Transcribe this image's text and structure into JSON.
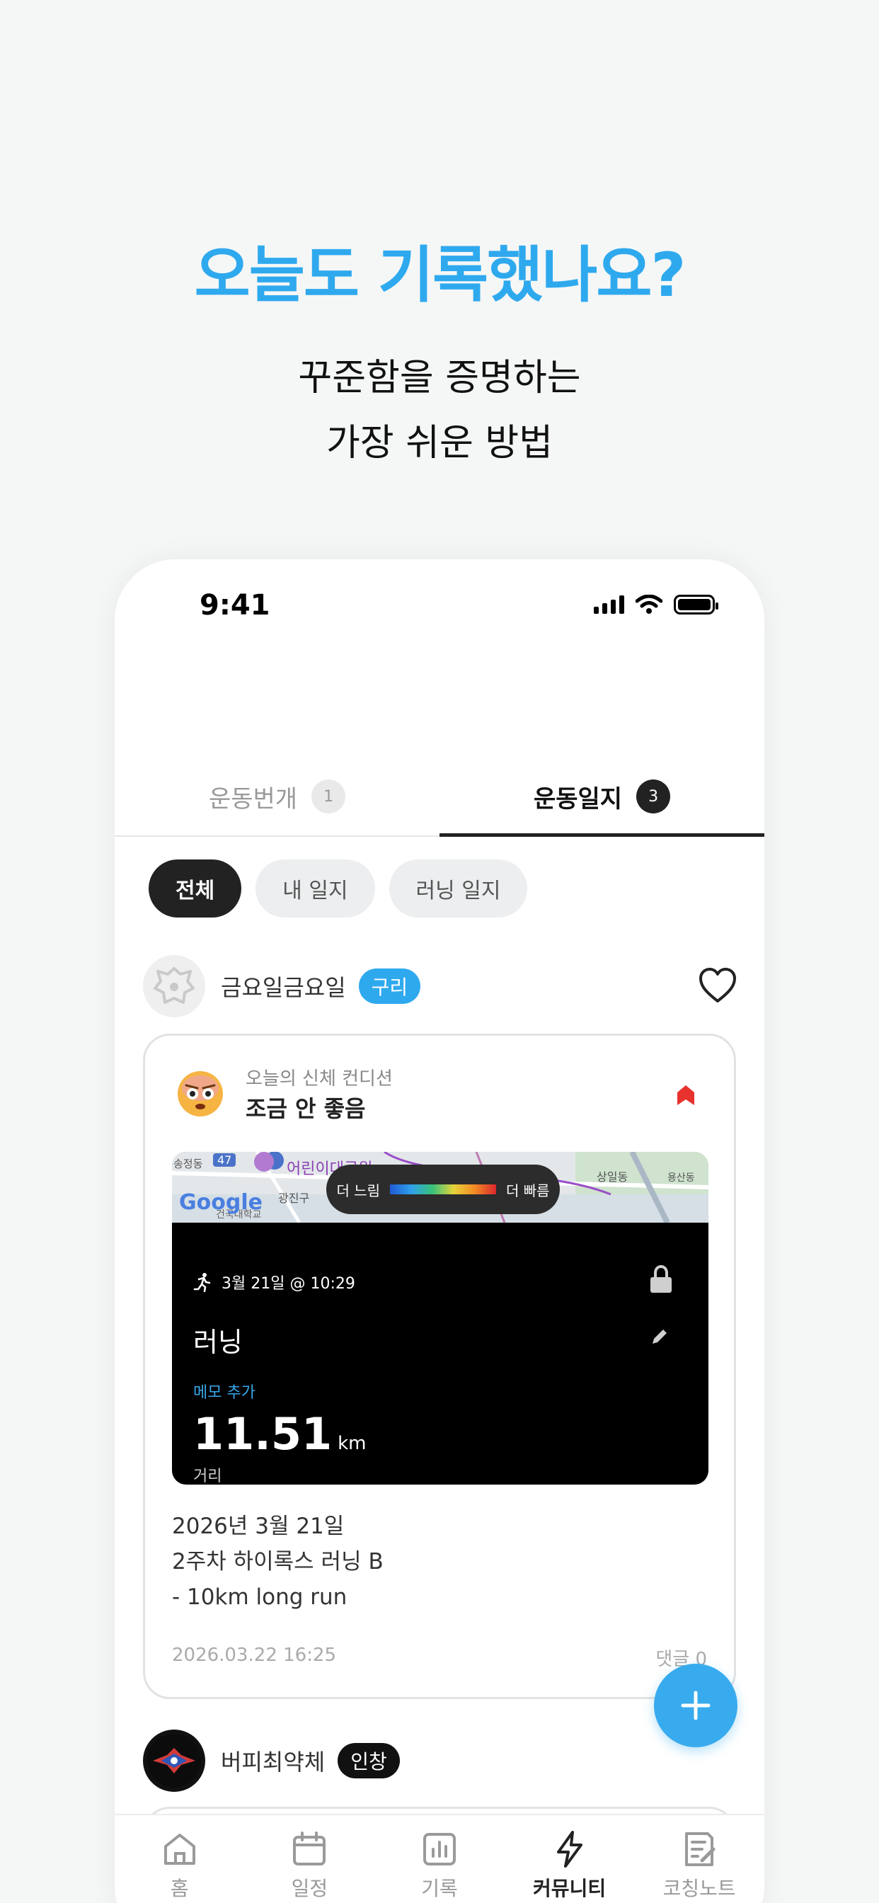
{
  "hero": {
    "title": "오늘도 기록했나요?",
    "sub_line1": "꾸준함을 증명하는",
    "sub_line2": "가장 쉬운 방법"
  },
  "status_bar": {
    "time": "9:41"
  },
  "tabs": [
    {
      "label": "운동번개",
      "count": "1",
      "active": false
    },
    {
      "label": "운동일지",
      "count": "3",
      "active": true
    }
  ],
  "filters": [
    {
      "label": "전체",
      "active": true
    },
    {
      "label": "내 일지",
      "active": false
    },
    {
      "label": "러닝 일지",
      "active": false
    }
  ],
  "post": {
    "author": "금요일금요일",
    "tag": "구리",
    "condition_label": "오늘의 신체 컨디션",
    "condition_value": "조금 안 좋음",
    "run": {
      "legend_slow": "더 느림",
      "legend_fast": "더 빠름",
      "date": "3월 21일 @ 10:29",
      "name": "러닝",
      "memo": "메모 추가",
      "distance": "11.51",
      "unit": "km",
      "distance_label": "거리",
      "map_labels": {
        "google": "Google",
        "place1": "어린이대공원",
        "place2": "광진구",
        "place3": "송정동",
        "place4": "상일동",
        "place5": "용산동",
        "route": "47",
        "school": "건국대학교"
      }
    },
    "text_line1": "2026년 3월 21일",
    "text_line2": "2주차 하이록스 러닝 B",
    "text_line3": "- 10km long run",
    "timestamp": "2026.03.22 16:25",
    "comments": "댓글 0"
  },
  "next_post": {
    "author": "버피최약체",
    "tag": "인창"
  },
  "bottom_nav": [
    {
      "label": "홈",
      "icon": "home-icon",
      "active": false
    },
    {
      "label": "일정",
      "icon": "calendar-icon",
      "active": false
    },
    {
      "label": "기록",
      "icon": "chart-icon",
      "active": false
    },
    {
      "label": "커뮤니티",
      "icon": "lightning-icon",
      "active": true
    },
    {
      "label": "코칭노트",
      "icon": "note-icon",
      "active": false
    }
  ],
  "colors": {
    "accent": "#2fa9ee",
    "dark": "#222222",
    "alert": "#e8322e"
  }
}
